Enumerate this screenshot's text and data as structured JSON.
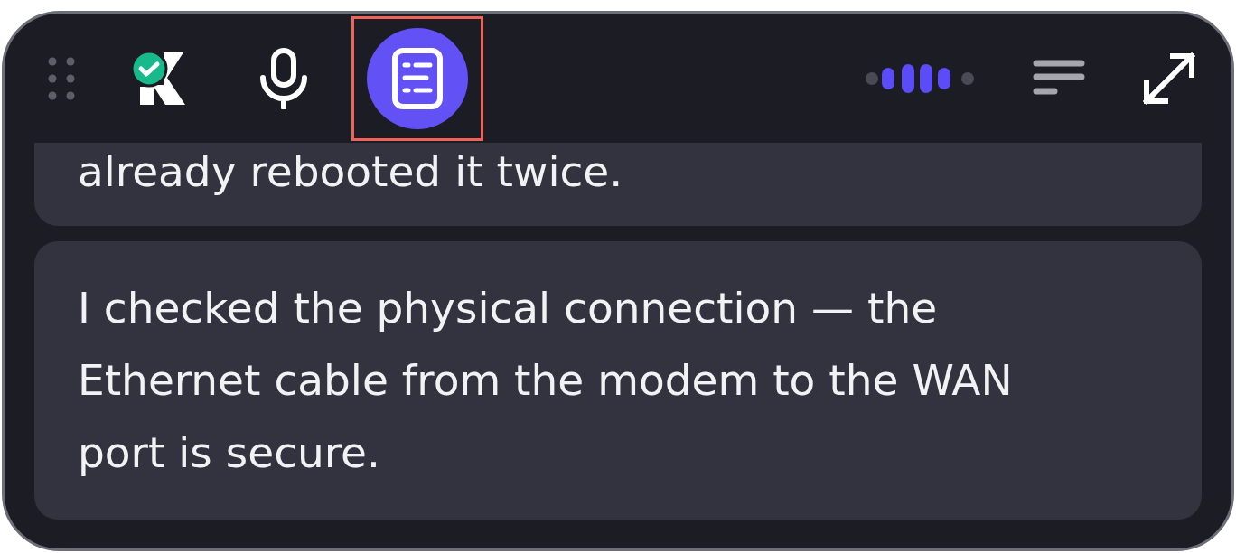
{
  "toolbar": {
    "left": [
      {
        "kind": "drag-handle"
      },
      {
        "kind": "logo",
        "verified": true
      },
      {
        "kind": "microphone",
        "selected": false,
        "highlighted": false
      },
      {
        "kind": "notes",
        "selected": true,
        "highlighted": true
      }
    ],
    "right": [
      {
        "kind": "voice-meter"
      },
      {
        "kind": "lines"
      },
      {
        "kind": "expand"
      }
    ]
  },
  "messages": [
    {
      "text": "already rebooted it twice."
    },
    {
      "text": "I checked the physical connection — the Ethernet cable from the modem to the WAN port is secure."
    }
  ]
}
